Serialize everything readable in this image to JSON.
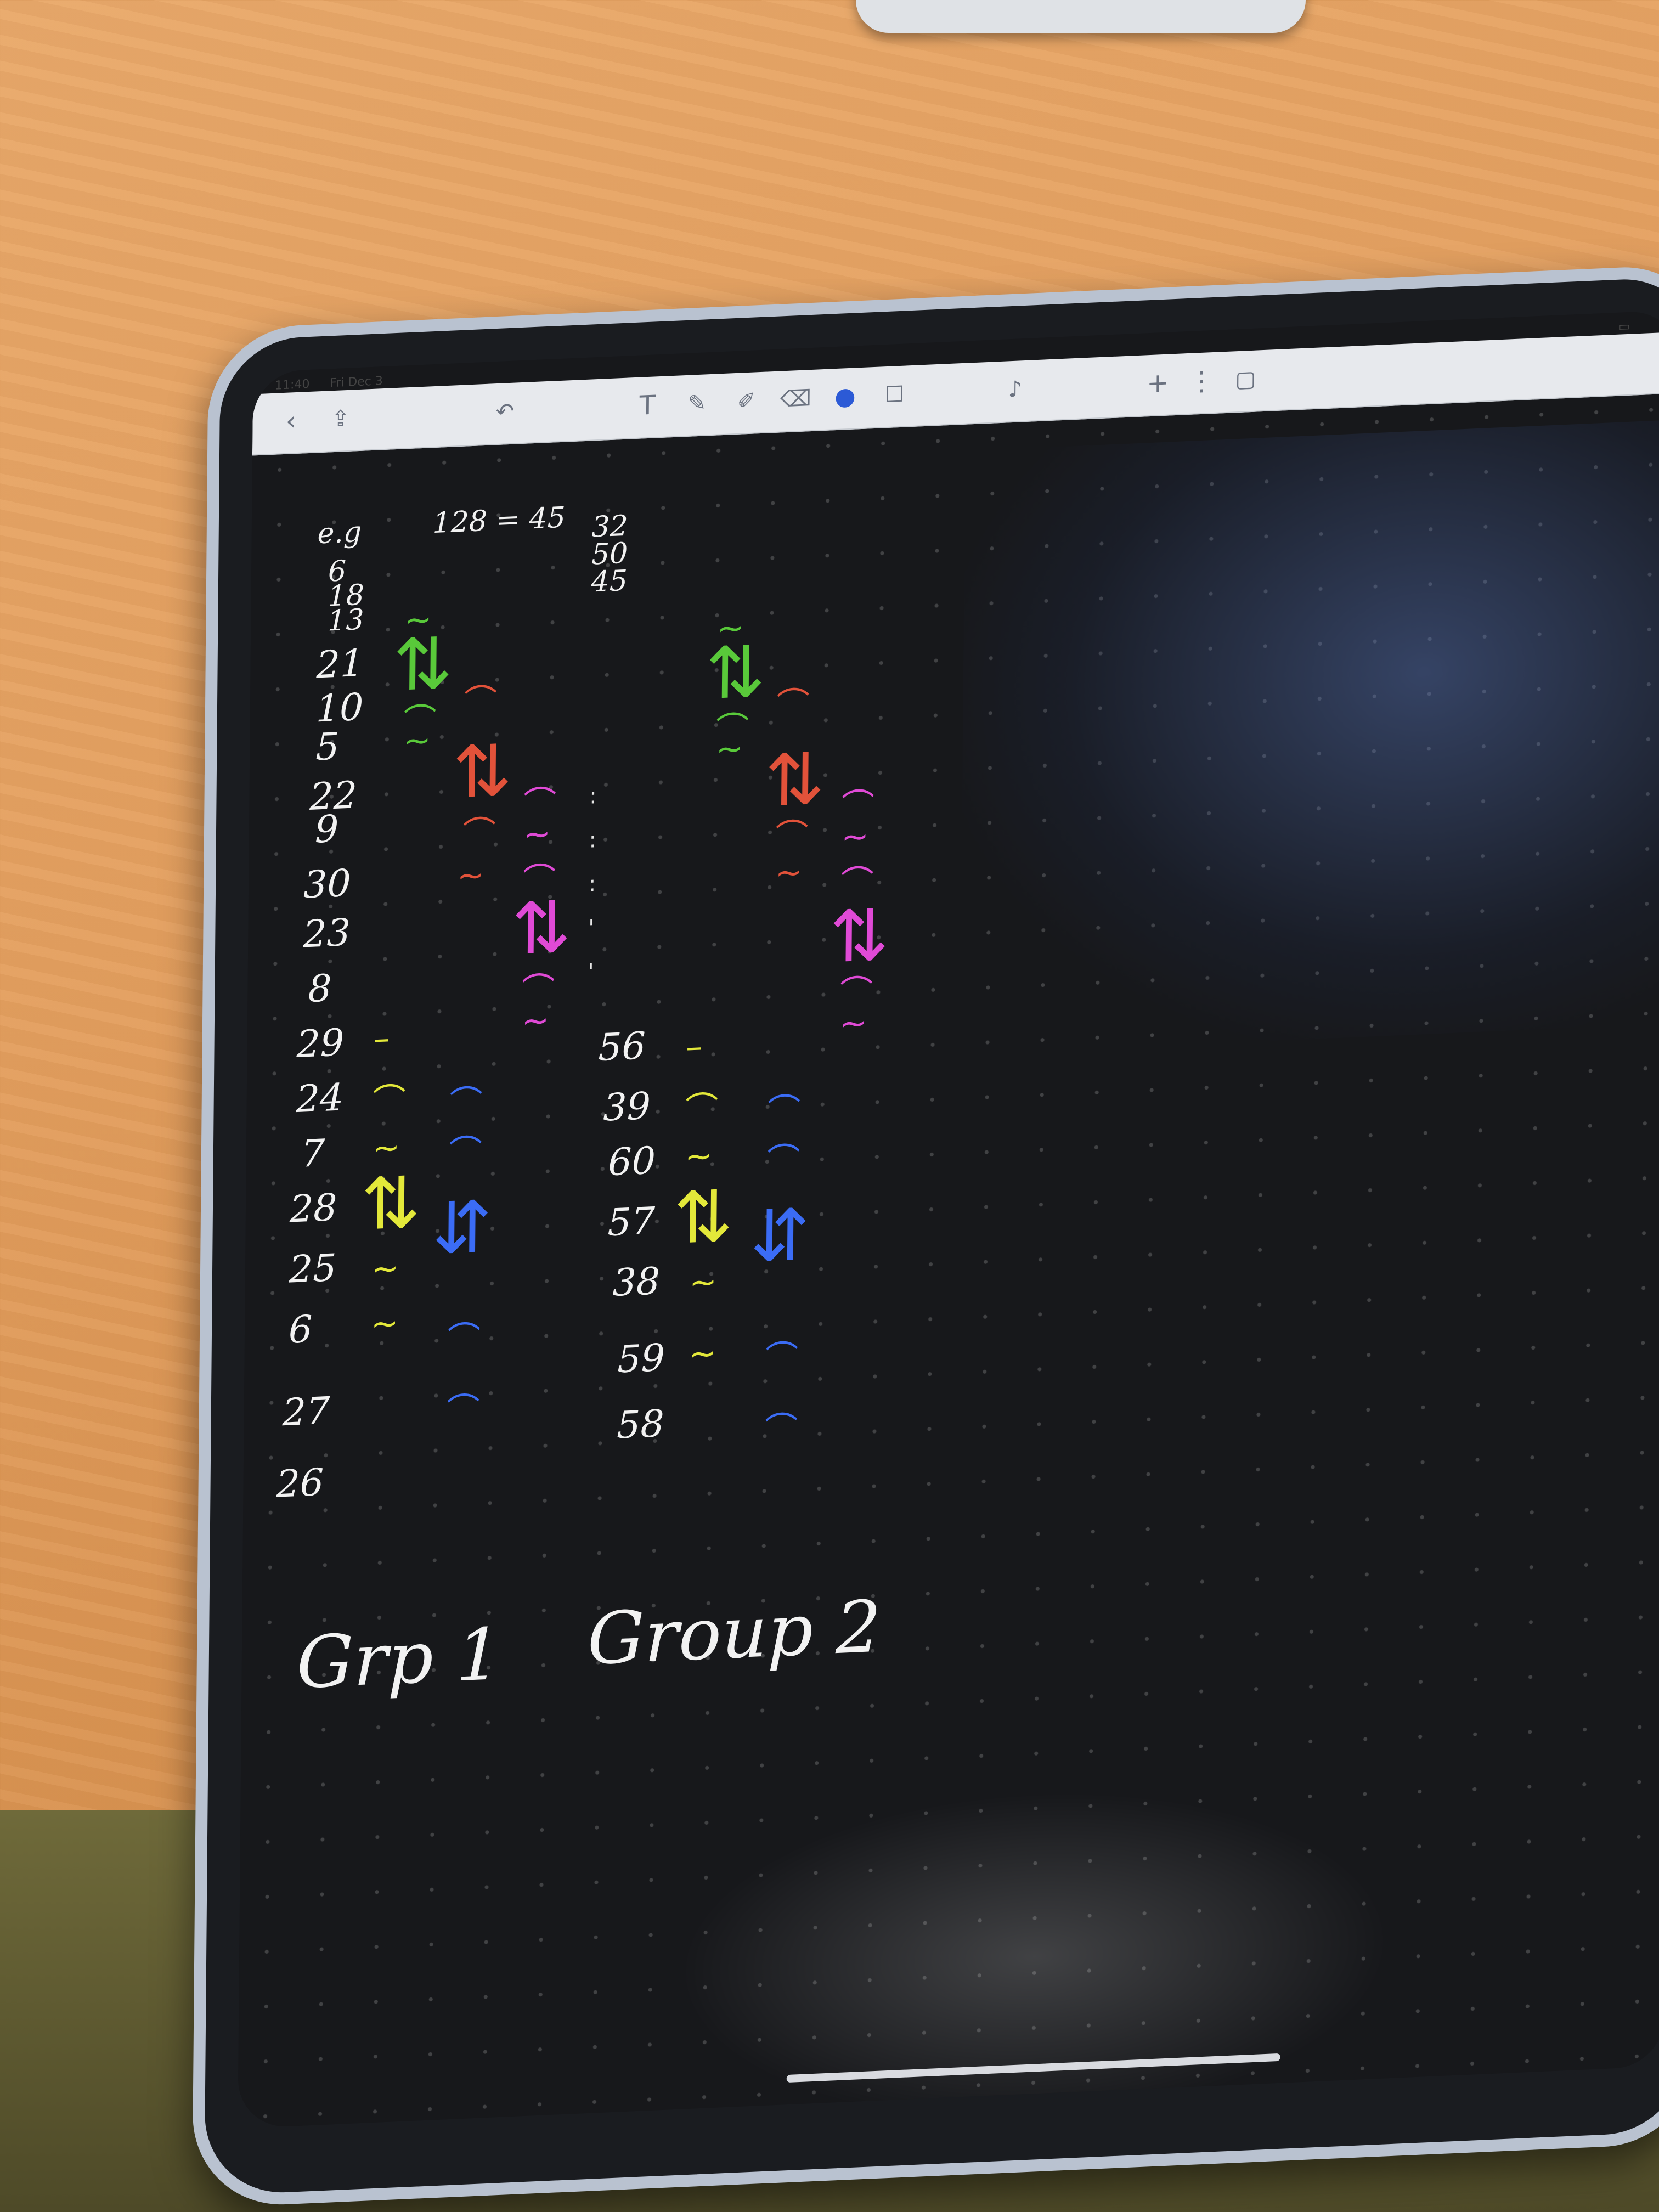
{
  "status": {
    "time": "11:40",
    "date": "Fri Dec 3"
  },
  "toolbar": {
    "icons": [
      "back-icon",
      "share-icon",
      "undo-icon",
      "text-tool-icon",
      "pen-icon",
      "highlighter-icon",
      "eraser-icon",
      "lasso-icon",
      "shapes-icon",
      "mic-icon",
      "add-page-icon",
      "more-icon",
      "pages-icon"
    ]
  },
  "notes": {
    "header_left": "e.g",
    "header_mid": "128 = 45",
    "top_right_numbers": [
      "32",
      "50",
      "45"
    ],
    "top_left_numbers": [
      "6",
      "18",
      "13"
    ],
    "group1_numbers": [
      "21",
      "10",
      "5",
      "22",
      "9",
      "30",
      "23",
      "8",
      "29",
      "24",
      "7",
      "28",
      "25",
      "6",
      "27",
      "26"
    ],
    "group2_numbers": [
      "56",
      "39",
      "60",
      "57",
      "38",
      "59",
      "58"
    ],
    "group1_label": "Grp 1",
    "group2_label": "Group 2"
  },
  "colors": {
    "green": "#59c93a",
    "red": "#e2523a",
    "magenta": "#e04ad6",
    "yellow": "#e3e83a",
    "blue": "#3b6cf5",
    "ink": "#f2f2f2"
  }
}
